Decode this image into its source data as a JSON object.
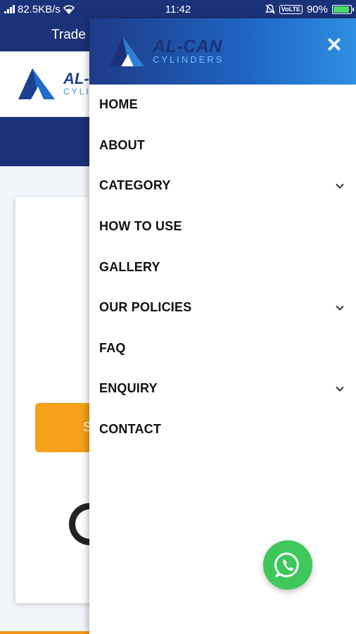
{
  "status_bar": {
    "network_speed": "82.5KB/s",
    "time": "11:42",
    "volte": "VoLTE",
    "battery": "90%",
    "battery_level": 0.9
  },
  "background_page": {
    "topbar_text": "Trade",
    "logo_brand": "AL-",
    "logo_sub": "CYLIN",
    "button_text": "S"
  },
  "drawer": {
    "logo_brand": "AL-CAN",
    "logo_sub": "CYLINDERS",
    "menu": [
      {
        "label": "HOME",
        "has_submenu": false
      },
      {
        "label": "ABOUT",
        "has_submenu": false
      },
      {
        "label": "CATEGORY",
        "has_submenu": true
      },
      {
        "label": "HOW TO USE",
        "has_submenu": false
      },
      {
        "label": "GALLERY",
        "has_submenu": false
      },
      {
        "label": "OUR POLICIES",
        "has_submenu": true
      },
      {
        "label": "FAQ",
        "has_submenu": false
      },
      {
        "label": "ENQUIRY",
        "has_submenu": true
      },
      {
        "label": "CONTACT",
        "has_submenu": false
      }
    ]
  },
  "colors": {
    "navy": "#1c3278",
    "accent_orange": "#f39416",
    "whatsapp_green": "#3ec75b"
  },
  "icons": {
    "close": "close-icon",
    "chevron": "chevron-down-icon",
    "whatsapp": "whatsapp-icon"
  }
}
